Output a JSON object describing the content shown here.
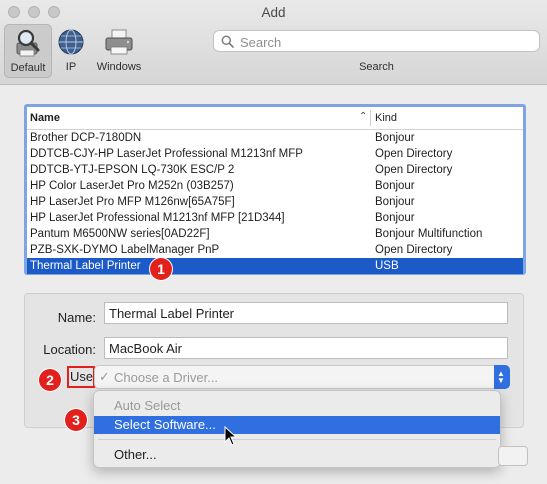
{
  "window": {
    "title": "Add"
  },
  "toolbar": {
    "tools": [
      {
        "label": "Default",
        "icon": "default-printer-icon",
        "selected": true
      },
      {
        "label": "IP",
        "icon": "globe-icon",
        "selected": false
      },
      {
        "label": "Windows",
        "icon": "windows-printer-icon",
        "selected": false
      }
    ],
    "search": {
      "placeholder": "Search",
      "label": "Search",
      "icon": "magnifier-icon"
    }
  },
  "printer_list": {
    "columns": {
      "name": "Name",
      "kind": "Kind"
    },
    "rows": [
      {
        "name": "Brother DCP-7180DN",
        "kind": "Bonjour"
      },
      {
        "name": "DDTCB-CJY-HP LaserJet Professional M1213nf MFP",
        "kind": "Open Directory"
      },
      {
        "name": "DDTCB-YTJ-EPSON LQ-730K ESC/P 2",
        "kind": "Open Directory"
      },
      {
        "name": "HP Color LaserJet Pro M252n (03B257)",
        "kind": "Bonjour"
      },
      {
        "name": "HP LaserJet Pro MFP M126nw[65A75F]",
        "kind": "Bonjour"
      },
      {
        "name": "HP LaserJet Professional M1213nf MFP [21D344]",
        "kind": "Bonjour"
      },
      {
        "name": "Pantum M6500NW series[0AD22F]",
        "kind": "Bonjour Multifunction"
      },
      {
        "name": "PZB-SXK-DYMO LabelManager PnP",
        "kind": "Open Directory"
      },
      {
        "name": "Thermal Label Printer",
        "kind": "USB",
        "selected": true
      }
    ]
  },
  "form": {
    "name_label": "Name:",
    "name_value": "Thermal Label Printer",
    "location_label": "Location:",
    "location_value": "MacBook Air",
    "use_label": "Use",
    "driver_checkmark": "✓",
    "driver_value": "Choose a Driver...",
    "driver_menu": {
      "items": [
        {
          "label": "Auto Select",
          "state": "disabled"
        },
        {
          "label": "Select Software...",
          "state": "active"
        },
        {
          "label": "Other...",
          "state": "normal"
        }
      ]
    }
  },
  "annotations": [
    {
      "label": "1"
    },
    {
      "label": "2"
    },
    {
      "label": "3"
    }
  ],
  "colors": {
    "selection_blue": "#1c5bc7",
    "menu_highlight": "#2f6fe0",
    "annotation_red": "#e2211c"
  }
}
